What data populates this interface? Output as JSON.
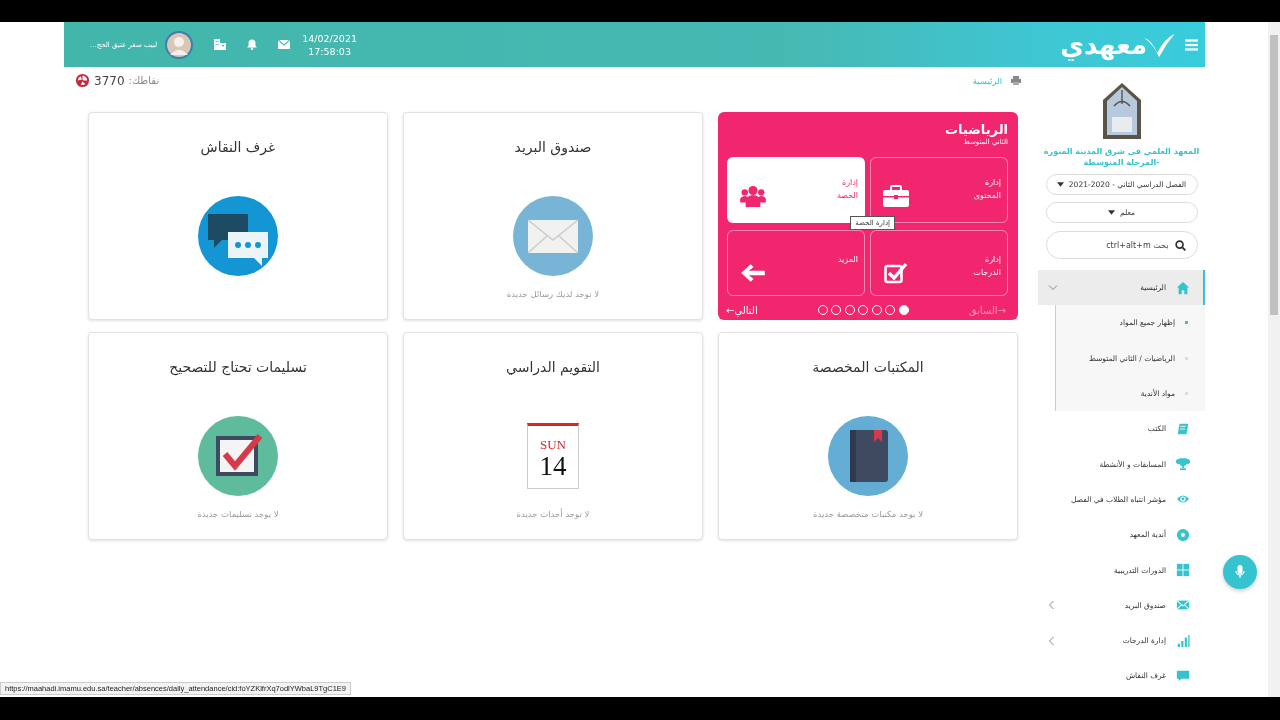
{
  "header": {
    "logo_text": "معهدي",
    "date": "14/02/2021",
    "time": "17:58:03",
    "user_name": "لبيب سفر عتيق الحج..."
  },
  "breadcrumb": {
    "label": "الرئيسية"
  },
  "points": {
    "label": "نقاطك:",
    "value": "3770"
  },
  "subject_card": {
    "title": "الرياضيات",
    "subtitle": "الثاني المتوسط",
    "tiles": [
      {
        "label": "إدارة المحتوى",
        "kind": "briefcase",
        "highlighted": false
      },
      {
        "label": "إدارة الحصة",
        "kind": "people",
        "highlighted": true
      },
      {
        "label": "إدارة الدرجات",
        "kind": "check",
        "highlighted": false
      },
      {
        "label": "المزيد",
        "kind": "arrow",
        "highlighted": false
      }
    ],
    "tooltip": "إدارة الحصة",
    "prev": {
      "label": "→السابق",
      "disabled": true
    },
    "next": {
      "label": "التالي←",
      "disabled": false
    },
    "slides": [
      {
        "selected": true
      },
      {
        "selected": false
      },
      {
        "selected": false
      },
      {
        "selected": false
      },
      {
        "selected": false
      },
      {
        "selected": false
      },
      {
        "selected": false
      }
    ]
  },
  "cards": [
    {
      "title": "صندوق البريد",
      "kind": "mail",
      "message": "لا توجد لديك رسائل جديدة"
    },
    {
      "title": "غرف النقاش",
      "kind": "chat"
    },
    {
      "title": "المكتبات المخصصة",
      "kind": "library",
      "message": "لا يوجد مكتبات متخصصة جديدة"
    },
    {
      "title": "التقويم الدراسي",
      "kind": "calendar",
      "day_name": "SUN",
      "day_number": "14",
      "message": "لا توجد أحداث جديدة"
    },
    {
      "title": "تسليمات تحتاج للتصحيح",
      "kind": "submissions",
      "message": "لا يوجد تسليمات جديدة"
    }
  ],
  "sidebar": {
    "school_name": "المعهد العلمي في شرق المدينة المنورة -المرحلة المتوسطة",
    "term_dropdown": "الفصل الدراسي الثاني - 2020-2021",
    "role_dropdown": "معلم",
    "search": {
      "placeholder": "بحث ctrl+alt+m"
    },
    "menu": [
      {
        "label": "الرئيسية",
        "kind": "home",
        "selected": true,
        "expanded": true,
        "children": [
          {
            "label": "إظهار جميع المواد",
            "selected": true
          },
          {
            "label": "الرياضيات / الثاني المتوسط",
            "selected": false
          },
          {
            "label": "مواد الأندية",
            "selected": false
          }
        ]
      },
      {
        "label": "الكتب",
        "kind": "book",
        "selected": false
      },
      {
        "label": "المسابقات و الأنشطة",
        "kind": "trophy",
        "selected": false
      },
      {
        "label": "مؤشر انتباه الطلاب في الفصل",
        "kind": "eye",
        "selected": false
      },
      {
        "label": "أندية المعهد",
        "kind": "ball",
        "selected": false
      },
      {
        "label": "الدورات التدريبية",
        "kind": "grid",
        "selected": false
      },
      {
        "label": "صندوق البريد",
        "kind": "mail",
        "selected": false,
        "expanded": false
      },
      {
        "label": "إدارة الدرجات",
        "kind": "bars",
        "selected": false,
        "expanded": false
      },
      {
        "label": "غرف النقاش",
        "kind": "chat",
        "selected": false
      }
    ]
  },
  "status_url": "https://maahadi.imamu.edu.sa/teacher/absences/daily_attendance/cid:foYZKlfrXq7odlYWbaL9TgC1E9"
}
